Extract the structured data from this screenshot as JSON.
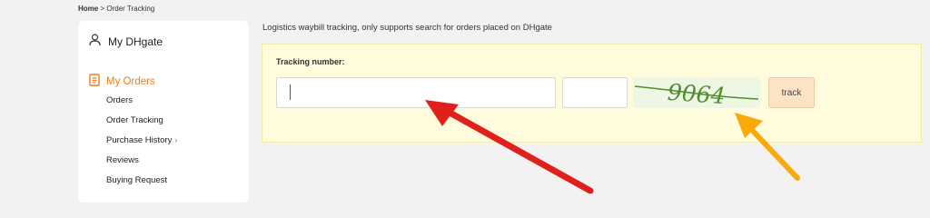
{
  "breadcrumb": {
    "home": "Home",
    "separator": " > ",
    "current": "Order Tracking"
  },
  "sidebar": {
    "account_label": "My DHgate",
    "orders_label": "My Orders",
    "items": [
      {
        "label": "Orders"
      },
      {
        "label": "Order Tracking"
      },
      {
        "label": "Purchase History",
        "chevron": "›"
      },
      {
        "label": "Reviews"
      },
      {
        "label": "Buying Request"
      }
    ]
  },
  "main": {
    "description": "Logistics waybill tracking, only supports search for orders placed on DHgate",
    "tracking_label": "Tracking number:",
    "tracking_value": "",
    "captcha_value": "",
    "captcha_text": "9064",
    "track_button": "track"
  },
  "colors": {
    "accent": "#f07c1b",
    "panel_bg": "#fffbdd",
    "captcha_text": "#4d8f2e",
    "red_arrow": "#e0201a",
    "orange_arrow": "#f9a90a"
  },
  "icons": {
    "account": "user-icon",
    "orders": "document-icon",
    "captcha": "captcha-image"
  }
}
